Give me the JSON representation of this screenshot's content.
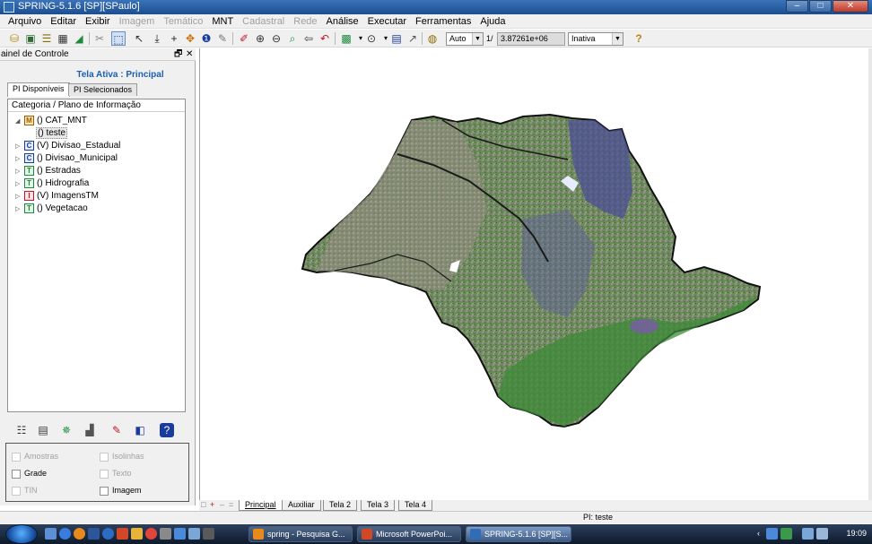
{
  "window": {
    "title": "SPRING-5.1.6 [SP][SPaulo]",
    "controls": [
      "–",
      "□",
      "✕"
    ]
  },
  "menu": [
    {
      "label": "Arquivo",
      "enabled": true
    },
    {
      "label": "Editar",
      "enabled": true
    },
    {
      "label": "Exibir",
      "enabled": true
    },
    {
      "label": "Imagem",
      "enabled": false
    },
    {
      "label": "Temático",
      "enabled": false
    },
    {
      "label": "MNT",
      "enabled": true
    },
    {
      "label": "Cadastral",
      "enabled": false
    },
    {
      "label": "Rede",
      "enabled": false
    },
    {
      "label": "Análise",
      "enabled": true
    },
    {
      "label": "Executar",
      "enabled": true
    },
    {
      "label": "Ferramentas",
      "enabled": true
    },
    {
      "label": "Ajuda",
      "enabled": true
    }
  ],
  "toolbar": {
    "zoom_mode": "Auto",
    "scale_prefix": "1/",
    "scale_value": "3.87261e+06",
    "state": "Inativa",
    "help_glyph": "?"
  },
  "panel": {
    "title": "ainel de Controle",
    "controls": [
      "🗗",
      "✕"
    ],
    "active_screen": "Tela Ativa : Principal",
    "tabs": [
      "PI Disponíveis",
      "PI Selecionados"
    ],
    "tree_header": "Categoria / Plano de Informação",
    "tree": [
      {
        "expander": "◢",
        "badge": "M",
        "badge_color": "#a05a00",
        "label": "() CAT_MNT",
        "depth": 0
      },
      {
        "expander": "",
        "badge": "",
        "label": "() teste",
        "depth": 1,
        "selected": true
      },
      {
        "expander": "▷",
        "badge": "C",
        "badge_color": "#1a3c9c",
        "label": "(V) Divisao_Estadual",
        "depth": 0
      },
      {
        "expander": "▷",
        "badge": "C",
        "badge_color": "#1a3c9c",
        "label": "() Divisao_Municipal",
        "depth": 0
      },
      {
        "expander": "▷",
        "badge": "T",
        "badge_color": "#1c8a3a",
        "label": "() Estradas",
        "depth": 0
      },
      {
        "expander": "▷",
        "badge": "T",
        "badge_color": "#1c8a3a",
        "label": "() Hidrografia",
        "depth": 0
      },
      {
        "expander": "▷",
        "badge": "I",
        "badge_color": "#c0172a",
        "label": "(V) ImagensTM",
        "depth": 0
      },
      {
        "expander": "▷",
        "badge": "T",
        "badge_color": "#1c8a3a",
        "label": "() Vegetacao",
        "depth": 0
      }
    ],
    "checkboxes": [
      {
        "label": "Amostras",
        "enabled": false
      },
      {
        "label": "Isolinhas",
        "enabled": false
      },
      {
        "label": "Grade",
        "enabled": true
      },
      {
        "label": "Texto",
        "enabled": false
      },
      {
        "label": "TIN",
        "enabled": false
      },
      {
        "label": "Imagem",
        "enabled": true
      }
    ]
  },
  "screen_tabs": [
    "Principal",
    "Auxiliar",
    "Tela 2",
    "Tela 3",
    "Tela 4"
  ],
  "screen_tab_controls": [
    "□",
    "+",
    "–",
    "="
  ],
  "status": {
    "pi": "PI: teste"
  },
  "taskbar": {
    "tasks": [
      {
        "label": "spring - Pesquisa G...",
        "icon_color": "#e8891c"
      },
      {
        "label": "Microsoft PowerPoi...",
        "icon_color": "#d24726"
      },
      {
        "label": "SPRING-5.1.6 [SP][S...",
        "icon_color": "#2f6db5",
        "active": true
      }
    ],
    "clock": "19:09"
  },
  "colors": {
    "active_screen_text": "#1b5fb0",
    "title_bar": "#1c4e8f",
    "map_green": "#4d7a3a",
    "map_blue": "#3a3d8c",
    "map_outline": "#111111"
  }
}
